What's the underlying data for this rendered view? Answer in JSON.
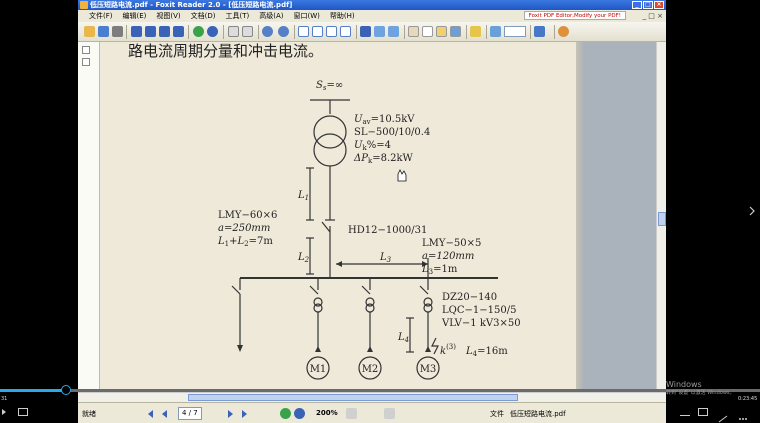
{
  "window": {
    "title": "低压短路电流.pdf - Foxit Reader 2.0 - [低压短路电流.pdf]",
    "controls": [
      "_",
      "□",
      "×"
    ]
  },
  "menubar": {
    "items": [
      "文件(F)",
      "编辑(E)",
      "视图(V)",
      "文档(D)",
      "工具(T)",
      "高级(A)",
      "窗口(W)",
      "帮助(H)"
    ],
    "ad_text": "Foxit PDF Editor,Modify your PDF!",
    "mdi_controls": "_ □ ×"
  },
  "document": {
    "heading": "路电流周期分量和冲击电流。",
    "diagram": {
      "source": "S",
      "source_sub": "s",
      "source_val": "=∞",
      "transformer_specs": [
        "U",
        "av",
        "=10.5kV",
        "SL−500/10/0.4",
        "U",
        "k",
        "%=4",
        "ΔP",
        "k",
        "=8.2kW"
      ],
      "l1": "L",
      "l1_sub": "1",
      "l2": "L",
      "l2_sub": "2",
      "l3": "L",
      "l3_sub": "3",
      "l4": "L",
      "l4_sub": "4",
      "busbar_left": [
        "LMY−60×6",
        "a=250mm",
        "L",
        "1",
        "+L",
        "2",
        "=7m"
      ],
      "switch_label": "HD12−1000/31",
      "busbar_right": [
        "LMY−50×5",
        "a=120mm",
        "L",
        "3",
        "=1m"
      ],
      "breaker_specs": [
        "DZ20−140",
        "LQC−1−150/5",
        "VLV−1 kV3×50"
      ],
      "fault": "k",
      "fault_sup": "(3)",
      "l4_val": "=16m",
      "motors": [
        "M1",
        "M2",
        "M3"
      ]
    }
  },
  "statusbar": {
    "ready": "就绪",
    "page": "4 / 7",
    "zoom": "200%",
    "file_label": "文件",
    "file_name": "低压短路电流.pdf"
  },
  "overlay": {
    "time_left": "31",
    "time_right": "0:23:45",
    "watermark_line1": "Windows",
    "watermark_line2": "转到\"设置\"以激活 Windows。"
  }
}
